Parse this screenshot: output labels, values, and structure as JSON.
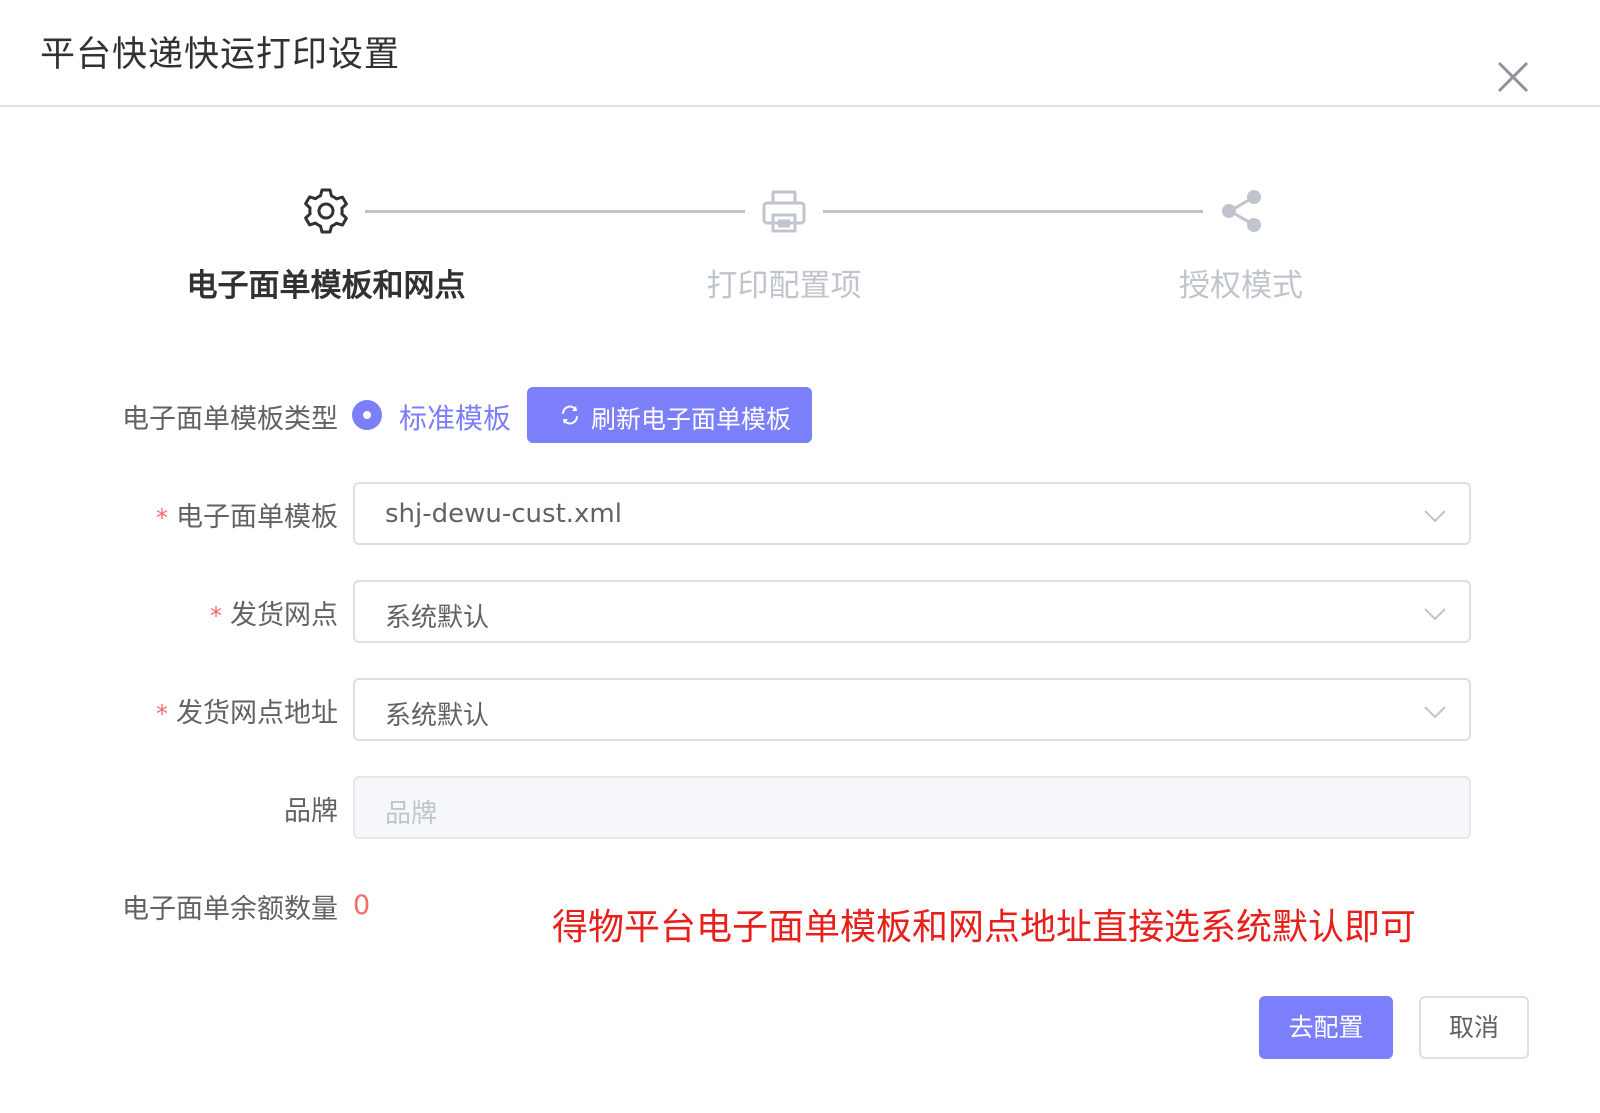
{
  "dialog": {
    "title": "平台快递快运打印设置",
    "close_icon": "close-icon"
  },
  "steps": [
    {
      "label": "电子面单模板和网点",
      "icon": "gear-icon",
      "active": true
    },
    {
      "label": "打印配置项",
      "icon": "printer-icon",
      "active": false
    },
    {
      "label": "授权模式",
      "icon": "share-icon",
      "active": false
    }
  ],
  "form": {
    "template_type": {
      "label": "电子面单模板类型",
      "radio_label": "标准模板",
      "refresh_button": "刷新电子面单模板",
      "refresh_icon": "refresh-icon"
    },
    "template": {
      "required": "*",
      "label": "电子面单模板",
      "value": "shj-dewu-cust.xml"
    },
    "outlet": {
      "required": "*",
      "label": "发货网点",
      "value": "系统默认"
    },
    "outlet_address": {
      "required": "*",
      "label": "发货网点地址",
      "value": "系统默认"
    },
    "brand": {
      "label": "品牌",
      "placeholder": "品牌"
    },
    "balance": {
      "label": "电子面单余额数量",
      "value": "0"
    }
  },
  "note": "得物平台电子面单模板和网点地址直接选系统默认即可",
  "footer": {
    "confirm_label": "去配置",
    "cancel_label": "取消"
  },
  "colors": {
    "primary": "#7b7ffa",
    "danger": "#f56c6c",
    "note_red": "#e8201c",
    "inactive": "#c0c4cc"
  }
}
